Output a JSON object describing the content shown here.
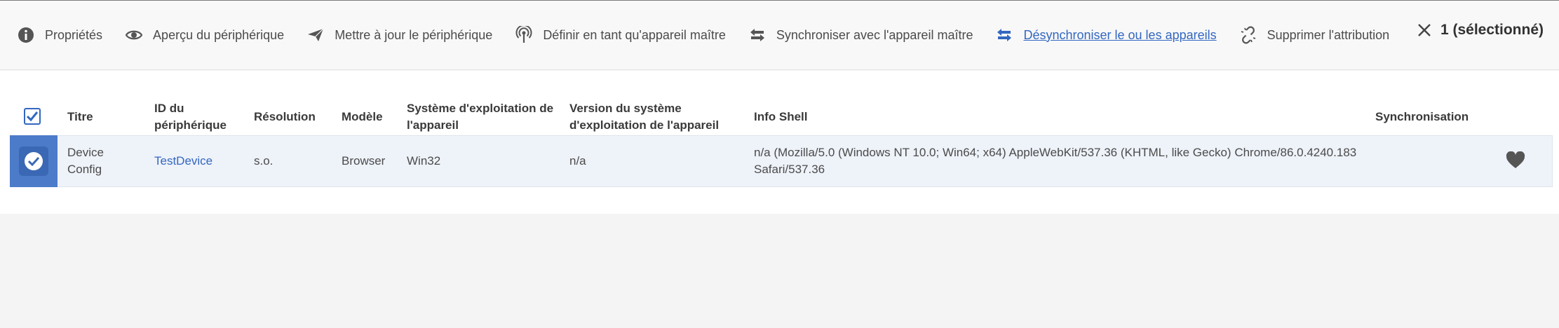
{
  "toolbar": {
    "items": [
      {
        "label": "Propriétés",
        "icon": "info-icon"
      },
      {
        "label": "Aperçu du périphérique",
        "icon": "eye-icon"
      },
      {
        "label": "Mettre à jour le périphérique",
        "icon": "send-icon"
      },
      {
        "label": "Définir en tant qu'appareil maître",
        "icon": "broadcast-icon"
      },
      {
        "label": "Synchroniser avec l'appareil maître",
        "icon": "sync-arrows-icon"
      },
      {
        "label": "Désynchroniser le ou les appareils",
        "icon": "unsync-arrows-icon"
      },
      {
        "label": "Supprimer l'attribution",
        "icon": "unlink-icon"
      }
    ],
    "selection_label": "1 (sélectionné)"
  },
  "table": {
    "headers": {
      "titre": "Titre",
      "id_line1": "ID du",
      "id_line2": "périphérique",
      "resolution": "Résolution",
      "modele": "Modèle",
      "os_line1": "Système d'exploitation de",
      "os_line2": "l'appareil",
      "osver_line1": "Version du système",
      "osver_line2": "d'exploitation de l'appareil",
      "shell": "Info Shell",
      "sync": "Synchronisation"
    },
    "rows": [
      {
        "title_line1": "Device",
        "title_line2": "Config",
        "device_id": "TestDevice",
        "resolution": "s.o.",
        "model": "Browser",
        "os": "Win32",
        "os_version": "n/a",
        "shell_line1": "n/a (Mozilla/5.0 (Windows NT 10.0; Win64; x64) AppleWebKit/537.36 (KHTML, like Gecko) Chrome/86.0.4240.183",
        "shell_line2": "Safari/537.36",
        "sync_icon": "heart-icon"
      }
    ]
  },
  "colors": {
    "accent": "#3367c0",
    "selected_row": "#4b7bc9",
    "row_bg": "#eef2f9"
  }
}
